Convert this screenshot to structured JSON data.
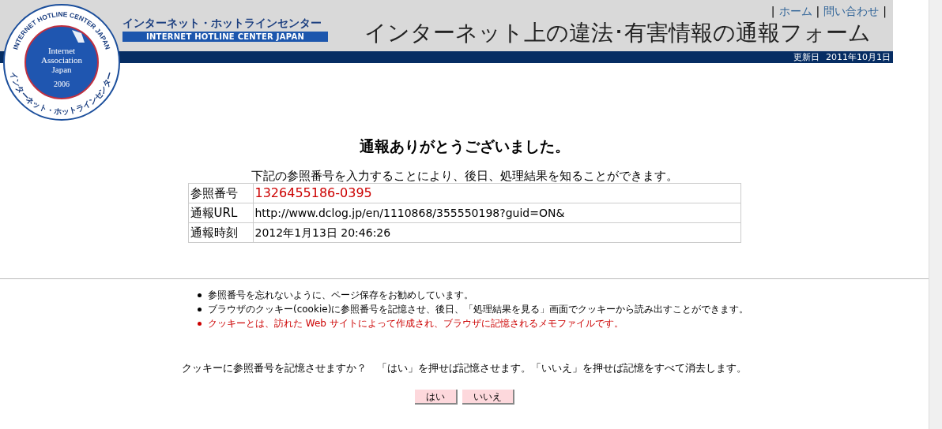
{
  "header": {
    "logo": {
      "ring_text": "INTERNET HOTLINE CENTER JAPAN",
      "center_lines": [
        "Internet",
        "Association",
        "Japan"
      ],
      "year": "2006",
      "bottom_text": "インターネット・ホットラインセンター"
    },
    "brand_ja": "インターネット・ホットラインセンター",
    "brand_en": "INTERNET HOTLINE CENTER JAPAN",
    "links": [
      {
        "label": "ホーム"
      },
      {
        "label": "問い合わせ"
      }
    ],
    "separator": "|",
    "title": "インターネット上の違法･有害情報の通報フォーム",
    "updated_label": "更新日",
    "updated_date": "2011年10月1日"
  },
  "heading": "通報ありがとうございました。",
  "intro": "下記の参照番号を入力することにより、後日、処理結果を知ることができます。",
  "table": {
    "rows": [
      {
        "label": "参照番号",
        "value": "1326455186-0395",
        "kind": "highlight"
      },
      {
        "label": "通報URL",
        "value": "http://www.dclog.jp/en/1110868/355550198?guid=ON&",
        "kind": "plain"
      },
      {
        "label": "通報時刻",
        "value": "2012年1月13日 20:46:26",
        "kind": "plain"
      }
    ]
  },
  "notes": [
    {
      "text": "参照番号を忘れないように、ページ保存をお勧めしています。",
      "color": "#000000"
    },
    {
      "text": "ブラウザのクッキー(cookie)に参照番号を記憶させ、後日、「処理結果を見る」画面でクッキーから読み出すことができます。",
      "color": "#000000"
    },
    {
      "text": "クッキーとは、訪れた Web サイトによって作成され、ブラウザに記憶されるメモファイルです。",
      "color": "#cc0000"
    }
  ],
  "question": "クッキーに参照番号を記憶させますか？　「はい」を押せば記憶させます。「いいえ」を押せば記憶をすべて消去します。",
  "buttons": [
    {
      "label": "はい"
    },
    {
      "label": "いいえ"
    }
  ]
}
